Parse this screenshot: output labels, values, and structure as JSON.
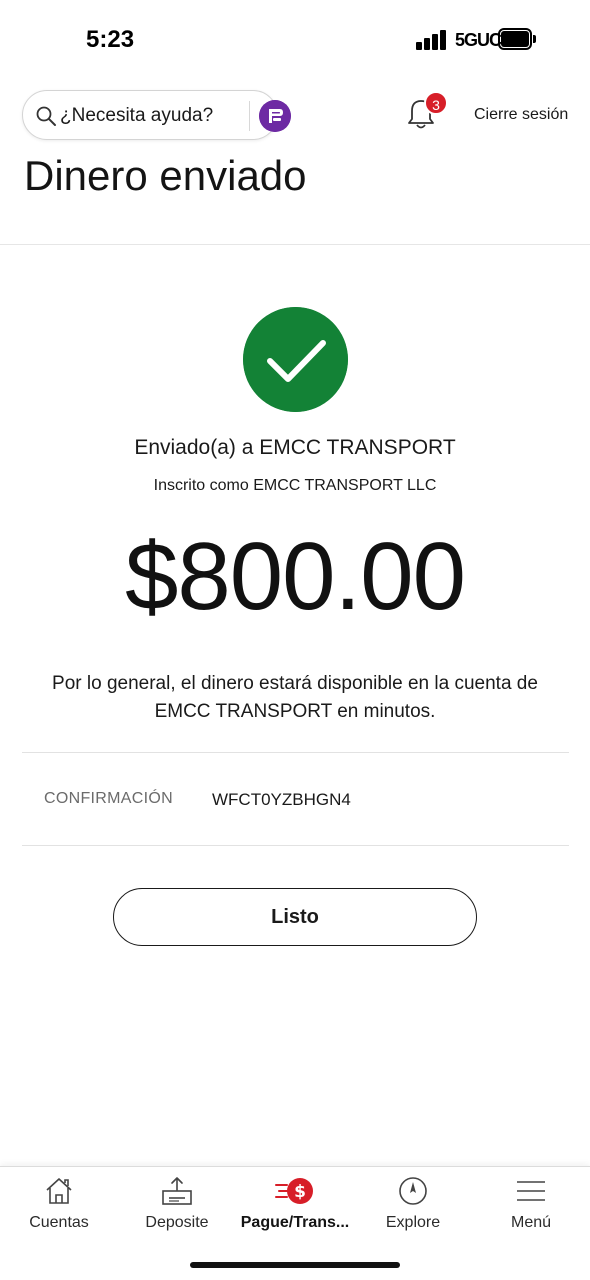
{
  "status_bar": {
    "time": "5:23",
    "network": "5GUC"
  },
  "header": {
    "help_placeholder": "¿Necesita ayuda?",
    "assistant_icon": "fargo-assistant-logo",
    "notification_count": "3",
    "signout_label": "Cierre sesión"
  },
  "page": {
    "title": "Dinero enviado"
  },
  "confirmation": {
    "recipient_line": "Enviado(a) a EMCC TRANSPORT",
    "enrolled_line": "Inscrito como EMCC TRANSPORT LLC",
    "amount": "$800.00",
    "availability_note": "Por lo general, el dinero estará disponible en la cuenta de EMCC TRANSPORT en minutos.",
    "confirmation_label": "CONFIRMACIÓN",
    "confirmation_number": "WFCT0YZBHGN4",
    "done_label": "Listo"
  },
  "tabbar": {
    "items": [
      {
        "label": "Cuentas",
        "icon": "home-icon"
      },
      {
        "label": "Deposite",
        "icon": "deposit-icon"
      },
      {
        "label": "Pague/Trans...",
        "icon": "pay-transfer-icon",
        "active": true
      },
      {
        "label": "Explore",
        "icon": "compass-icon"
      },
      {
        "label": "Menú",
        "icon": "menu-icon"
      }
    ]
  },
  "colors": {
    "success_green": "#138236",
    "badge_red": "#d71e28",
    "assistant_purple": "#6d2aa3"
  }
}
